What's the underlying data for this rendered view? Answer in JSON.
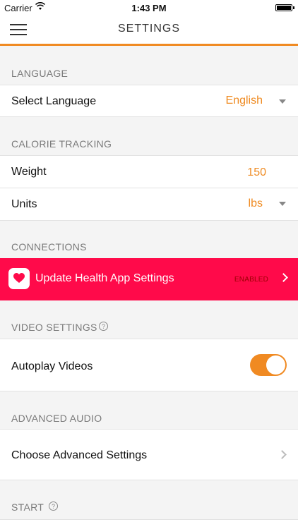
{
  "status_bar": {
    "carrier": "Carrier",
    "time": "1:43 PM"
  },
  "nav": {
    "title": "SETTINGS",
    "menu_icon": "hamburger-menu-icon"
  },
  "sections": {
    "language": {
      "header": "LANGUAGE",
      "row_label": "Select Language",
      "row_value": "English"
    },
    "calorie": {
      "header": "CALORIE TRACKING",
      "weight_label": "Weight",
      "weight_value": "150",
      "units_label": "Units",
      "units_value": "lbs"
    },
    "connections": {
      "header": "CONNECTIONS",
      "health_label": "Update Health App Settings",
      "health_status": "ENABLED",
      "health_color": "#ff0a4a"
    },
    "video": {
      "header": "VIDEO SETTINGS",
      "autoplay_label": "Autoplay Videos",
      "autoplay_on": true
    },
    "audio": {
      "header": "ADVANCED AUDIO",
      "row_label": "Choose Advanced Settings"
    },
    "start": {
      "header": "START"
    }
  },
  "colors": {
    "accent": "#f08a22",
    "background": "#f4f4f4"
  }
}
